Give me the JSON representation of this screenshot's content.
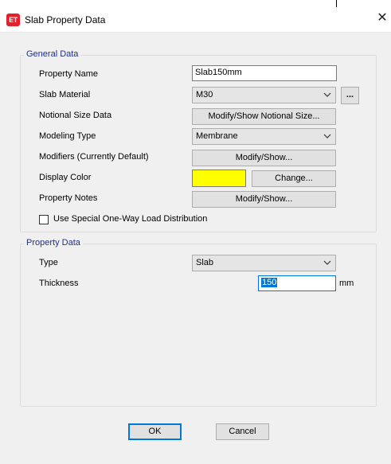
{
  "window": {
    "title": "Slab Property Data",
    "app_icon_text": "ET",
    "close_icon": "close-icon"
  },
  "general": {
    "legend": "General Data",
    "property_name_label": "Property Name",
    "property_name_value": "Slab150mm",
    "slab_material_label": "Slab Material",
    "slab_material_value": "M30",
    "slab_material_browse": "...",
    "notional_label": "Notional Size Data",
    "notional_button": "Modify/Show Notional Size...",
    "modeling_type_label": "Modeling Type",
    "modeling_type_value": "Membrane",
    "modifiers_label": "Modifiers (Currently Default)",
    "modifiers_button": "Modify/Show...",
    "display_color_label": "Display Color",
    "display_color_value": "#ffff00",
    "change_button": "Change...",
    "notes_label": "Property Notes",
    "notes_button": "Modify/Show...",
    "one_way_checkbox_label": "Use Special One-Way Load Distribution",
    "one_way_checked": false
  },
  "property": {
    "legend": "Property Data",
    "type_label": "Type",
    "type_value": "Slab",
    "thickness_label": "Thickness",
    "thickness_value": "150",
    "thickness_unit": "mm"
  },
  "footer": {
    "ok_label": "OK",
    "cancel_label": "Cancel"
  }
}
